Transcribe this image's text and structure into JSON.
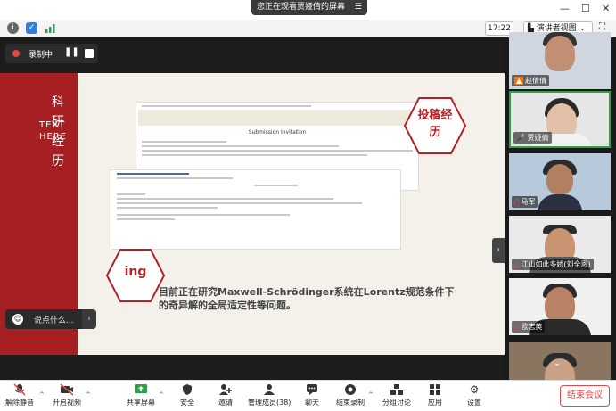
{
  "top": {
    "viewing_text": "您正在观看贾娅倩的屏幕"
  },
  "iconbar": {
    "time": "17:22",
    "view_label": "演讲者视图"
  },
  "recording": {
    "label": "录制中"
  },
  "slide": {
    "vertical_title": "科研经历",
    "vertical_sub": "TEXT HERE",
    "hex_right": "投稿经历",
    "hex_left": "ing",
    "doc_heading": "Submission Invitation",
    "body_text": "目前正在研究Maxwell-Schrödinger系统在Lorentz规范条件下的奇异解的全局适定性等问题。"
  },
  "chat": {
    "placeholder": "说点什么..."
  },
  "participants": [
    {
      "name": "赵倩倩"
    },
    {
      "name": "贾娅倩"
    },
    {
      "name": "马军"
    },
    {
      "name": "江山如此多娇(刘全恩)"
    },
    {
      "name": "欧志英"
    }
  ],
  "toolbar": {
    "mute": "解除静音",
    "video": "开启视频",
    "share": "共享屏幕",
    "security": "安全",
    "invite": "邀请",
    "members": "管理成员(38)",
    "chat": "聊天",
    "record": "结束录制",
    "breakout": "分组讨论",
    "apps": "应用",
    "settings": "设置",
    "end": "结束会议"
  }
}
